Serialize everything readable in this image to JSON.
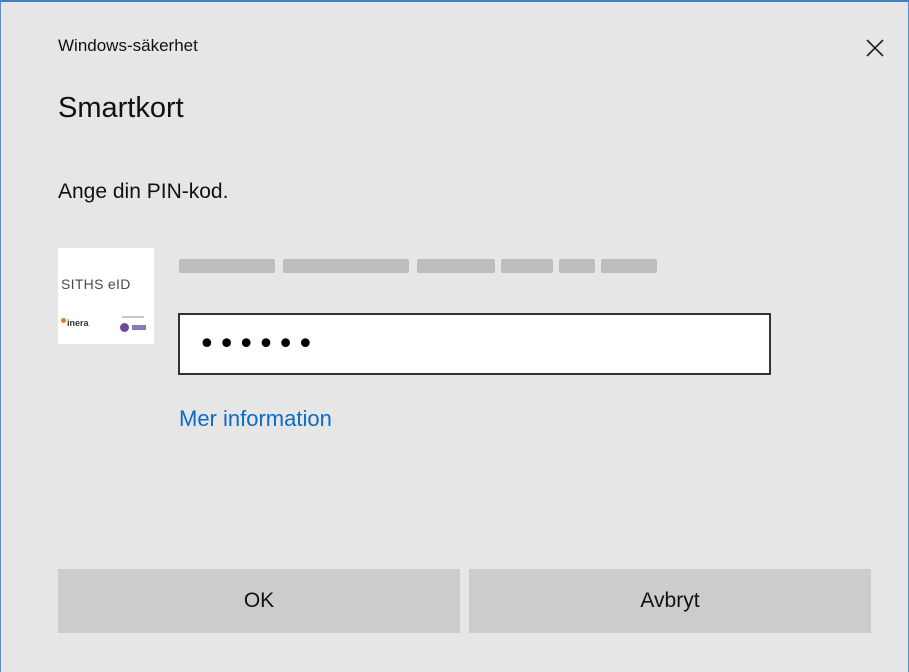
{
  "window": {
    "title": "Windows-säkerhet",
    "close_icon": "close-icon"
  },
  "dialog": {
    "heading": "Smartkort",
    "instruction": "Ange din PIN-kod.",
    "card_logo": {
      "text": "SITHS eID",
      "left_mark": "inera",
      "icon": "siths-eid-logo"
    },
    "user_line_redacted": true,
    "pin_field": {
      "value": "••••••",
      "type": "password"
    },
    "more_info_link": "Mer information",
    "ok_button": "OK",
    "cancel_button": "Avbryt"
  },
  "colors": {
    "background": "#e6e6e6",
    "link": "#0a6bc8",
    "button": "#cccccc",
    "window_border": "#3f7fc4"
  }
}
